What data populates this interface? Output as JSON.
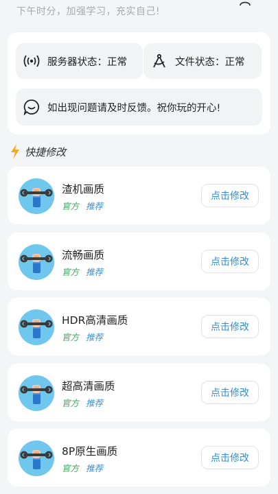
{
  "header": {
    "greeting": "下午时分，加强学习，充实自己!",
    "top_icon": "profile-icon"
  },
  "status": {
    "server_label": "服务器状态：正常",
    "server_icon": "signal-broadcast-icon",
    "file_label": "文件状态：正常",
    "file_icon": "compass-icon",
    "feedback_label": "如出现问题请及时反馈。祝你玩的开心!",
    "feedback_icon": "chat-bubble-icon"
  },
  "section": {
    "title": "快捷修改",
    "icon": "lightning-icon",
    "icon_color": "#f5a623"
  },
  "items": [
    {
      "title": "渣机画质",
      "tag_official": "官方",
      "tag_recommend": "推荐",
      "button": "点击修改"
    },
    {
      "title": "流畅画质",
      "tag_official": "官方",
      "tag_recommend": "推荐",
      "button": "点击修改"
    },
    {
      "title": "HDR高清画质",
      "tag_official": "官方",
      "tag_recommend": "推荐",
      "button": "点击修改"
    },
    {
      "title": "超高清画质",
      "tag_official": "官方",
      "tag_recommend": "推荐",
      "button": "点击修改"
    },
    {
      "title": "8P原生画质",
      "tag_official": "官方",
      "tag_recommend": "推荐",
      "button": "点击修改"
    }
  ],
  "colors": {
    "background": "#f4f5f7",
    "accent_blue": "#2e8fd6",
    "tag_green": "#3caa5c",
    "tag_blue": "#3f8fd8"
  }
}
